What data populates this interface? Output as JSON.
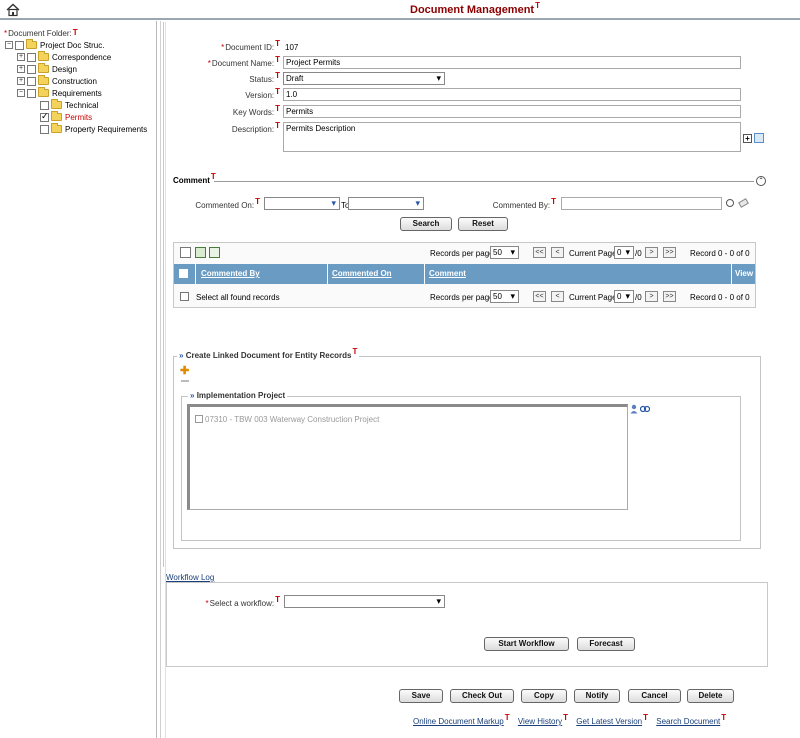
{
  "header": {
    "title": "Document Management"
  },
  "tree": {
    "root_label": "Document Folder:",
    "items": [
      {
        "label": "Project Doc Struc.",
        "expander": "−",
        "checked": false
      },
      {
        "label": "Correspondence",
        "expander": "+",
        "checked": false
      },
      {
        "label": "Design",
        "expander": "+",
        "checked": false
      },
      {
        "label": "Construction",
        "expander": "+",
        "checked": false
      },
      {
        "label": "Requirements",
        "expander": "−",
        "checked": false
      },
      {
        "label": "Technical",
        "checked": false
      },
      {
        "label": "Permits",
        "checked": true,
        "selected": true
      },
      {
        "label": "Property Requirements",
        "checked": false
      }
    ]
  },
  "form": {
    "doc_id_label": "Document ID:",
    "doc_id_value": "107",
    "doc_name_label": "Document Name:",
    "doc_name_value": "Project Permits",
    "status_label": "Status:",
    "status_value": "Draft",
    "version_label": "Version:",
    "version_value": "1.0",
    "keywords_label": "Key Words:",
    "keywords_value": "Permits",
    "description_label": "Description:",
    "description_value": "Permits Description"
  },
  "comment": {
    "section_title": "Comment",
    "commented_on_label": "Commented On:",
    "to_label": "To",
    "commented_by_label": "Commented By:",
    "search_button": "Search",
    "reset_button": "Reset",
    "records_per_page_label": "Records per page",
    "records_per_page_value": "50",
    "current_page_label": "Current Page",
    "current_page_value": "0",
    "page_total": "/0",
    "record_range": "Record 0 - 0 of 0",
    "first_page": "<<",
    "prev_page": "<",
    "next_page": ">",
    "last_page": ">>",
    "columns": [
      "Commented By",
      "Commented On",
      "Comment",
      "View"
    ],
    "select_all_label": "Select all found records"
  },
  "linked": {
    "section_title": "Create Linked Document for Entity Records",
    "sub_title": "Implementation Project",
    "entries": [
      "07310 - TBW 003 Waterway Construction Project"
    ]
  },
  "workflow": {
    "log_link": "Workflow Log",
    "select_label": "Select a workflow:",
    "select_value": "",
    "start_button": "Start Workflow",
    "forecast_button": "Forecast"
  },
  "actions": {
    "save": "Save",
    "checkout": "Check Out",
    "copy": "Copy",
    "notify": "Notify",
    "cancel": "Cancel",
    "delete": "Delete"
  },
  "footer_links": {
    "markup": "Online Document Markup",
    "history": "View History",
    "latest": "Get Latest Version",
    "search": "Search Document"
  },
  "marker": "T",
  "colors": {
    "title": "#8b0000",
    "grid_header": "#6a9bc3",
    "marker": "#cc0000",
    "selected": "#cc0000",
    "link": "#1a3f7a"
  }
}
